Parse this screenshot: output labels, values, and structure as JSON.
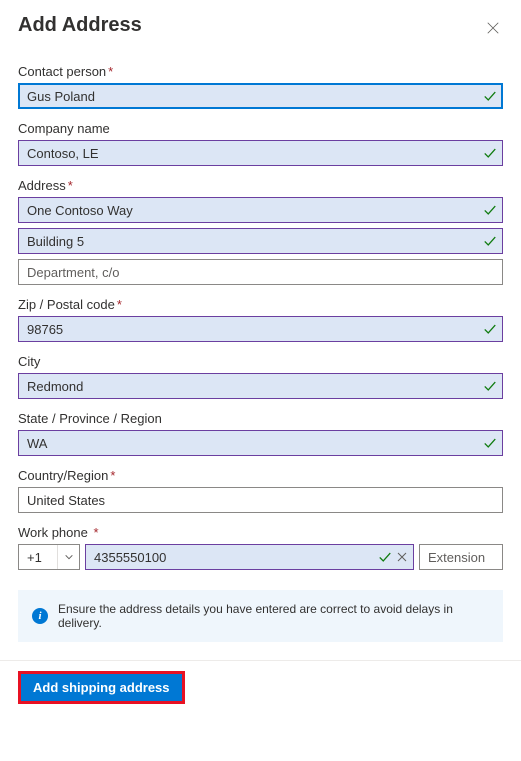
{
  "header": {
    "title": "Add Address"
  },
  "fields": {
    "contact": {
      "label": "Contact person",
      "required": true,
      "value": "Gus Poland"
    },
    "company": {
      "label": "Company name",
      "required": false,
      "value": "Contoso, LE"
    },
    "address": {
      "label": "Address",
      "required": true,
      "line1": "One Contoso Way",
      "line2": "Building 5",
      "line3_placeholder": "Department, c/o"
    },
    "zip": {
      "label": "Zip / Postal code",
      "required": true,
      "value": "98765"
    },
    "city": {
      "label": "City",
      "required": false,
      "value": "Redmond"
    },
    "state": {
      "label": "State / Province / Region",
      "required": false,
      "value": "WA"
    },
    "country": {
      "label": "Country/Region",
      "required": true,
      "value": "United States"
    },
    "phone": {
      "label": "Work phone",
      "required": true,
      "country_code": "+1",
      "number": "4355550100",
      "ext_placeholder": "Extension"
    }
  },
  "info": {
    "text": "Ensure the address details you have entered are correct to avoid delays in delivery."
  },
  "footer": {
    "submit_label": "Add shipping address"
  }
}
